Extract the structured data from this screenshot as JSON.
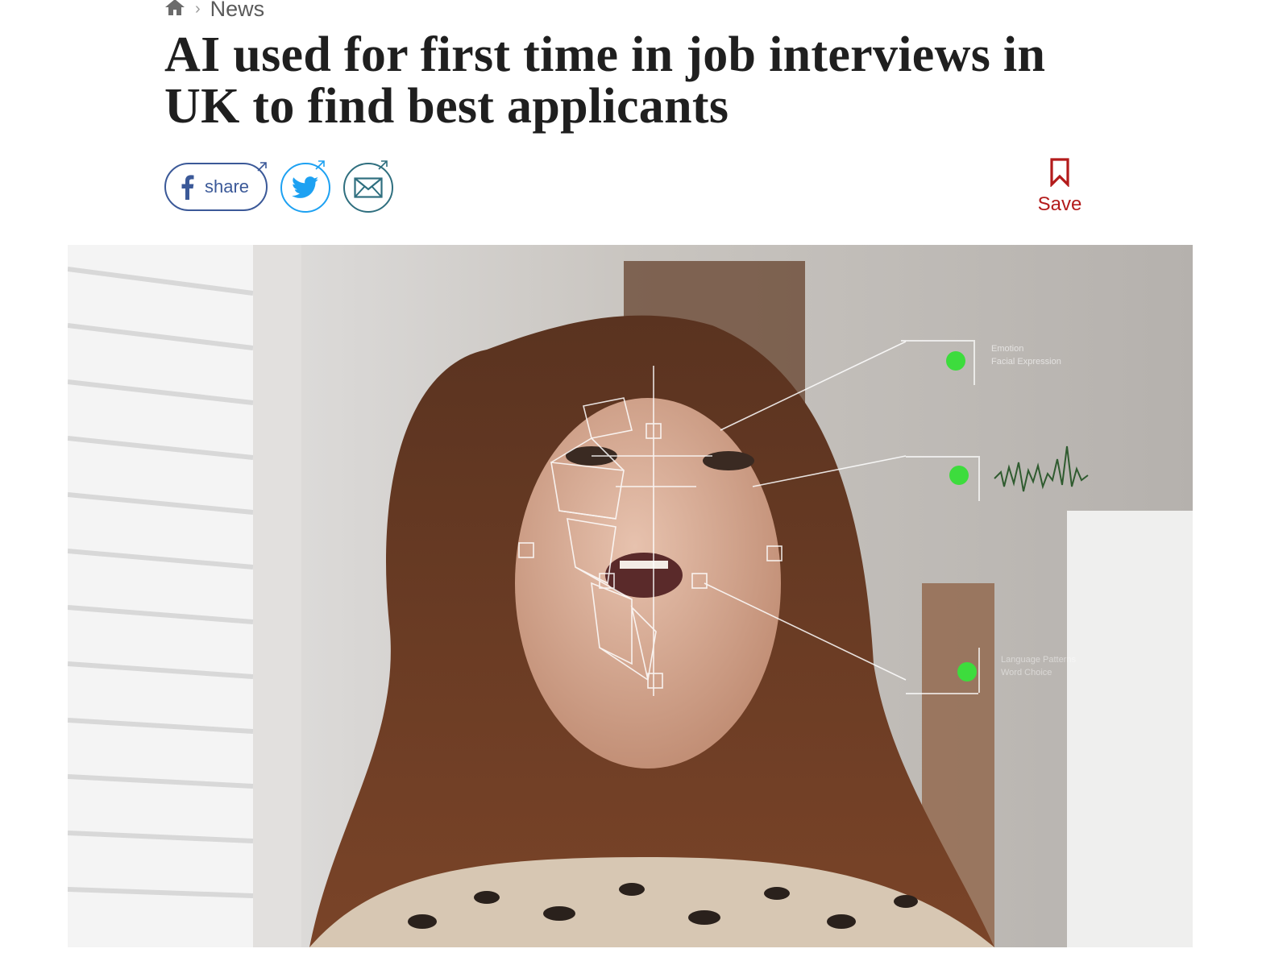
{
  "breadcrumb": {
    "home_icon": "home-icon",
    "section": "News"
  },
  "article": {
    "headline": "AI used for first time in job interviews in UK to find best applicants"
  },
  "share": {
    "facebook_label": "share",
    "facebook_icon": "facebook-icon",
    "twitter_icon": "twitter-icon",
    "email_icon": "mail-icon"
  },
  "save": {
    "label": "Save",
    "icon": "bookmark-icon"
  },
  "hero_image": {
    "overlay_labels": [
      "Emotion",
      "Facial Expression",
      "Language Patterns",
      "Word Choice"
    ]
  },
  "colors": {
    "facebook": "#3b5998",
    "twitter": "#1da1f2",
    "email": "#2f6f7f",
    "save": "#b31b1b",
    "headline": "#1f1f1f",
    "indicator": "#3ddc3d"
  }
}
